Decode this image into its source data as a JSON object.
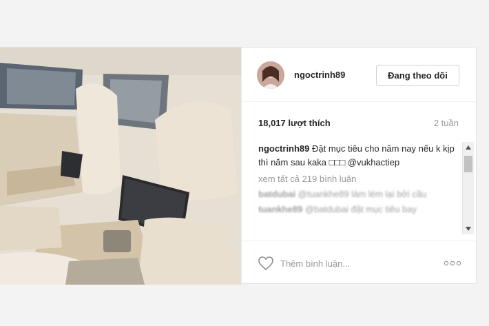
{
  "post": {
    "username": "ngoctrinh89",
    "follow_label": "Đang theo dõi",
    "likes": "18,017 lượt thích",
    "time_ago": "2 tuần",
    "caption": {
      "user": "ngoctrinh89",
      "text": "Đặt mục tiêu cho năm nay nếu k kịp thì năm sau kaka □□□ @vukhactiep"
    },
    "view_all_comments": "xem tất cả 219 bình luận",
    "comments": [
      {
        "user": "batdubai",
        "text": "@tuankhe89 làm lém lại bởi cầu"
      },
      {
        "user": "tuankhe89",
        "text": "@batdubai đặt mục tiêu bay"
      }
    ],
    "add_comment_placeholder": "Thêm bình luận...",
    "icons": {
      "like": "heart-outline-icon",
      "more": "ellipsis-icon",
      "scroll_up": "triangle-up-icon",
      "scroll_down": "triangle-down-icon"
    }
  }
}
